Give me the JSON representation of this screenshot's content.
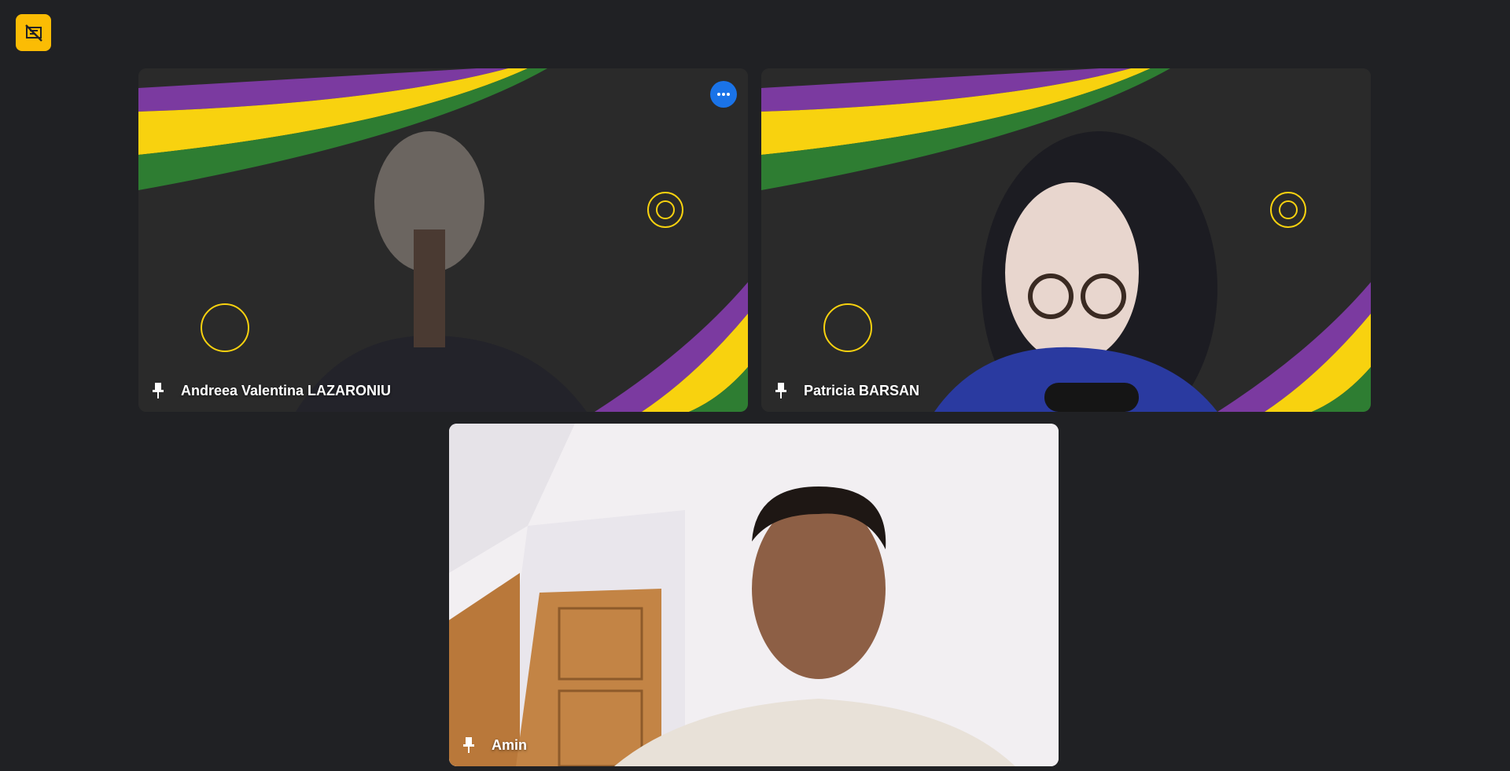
{
  "toolbar": {
    "badge_icon": "presentation-off-icon",
    "badge_color": "#fbbc04"
  },
  "participants": [
    {
      "name": "Andreea Valentina LAZARONIU",
      "pin_icon": "pin-icon",
      "has_more_button": true,
      "more_icon": "more-horiz-icon"
    },
    {
      "name": "Patricia BARSAN",
      "pin_icon": "pin-icon"
    },
    {
      "name": "Amin",
      "pin_icon": "pin-icon"
    }
  ],
  "colors": {
    "background": "#202124",
    "accent_blue": "#1a73e8",
    "brand_purple": "#7b3aa0",
    "brand_yellow": "#f8d20f",
    "brand_green": "#2e7d32"
  }
}
